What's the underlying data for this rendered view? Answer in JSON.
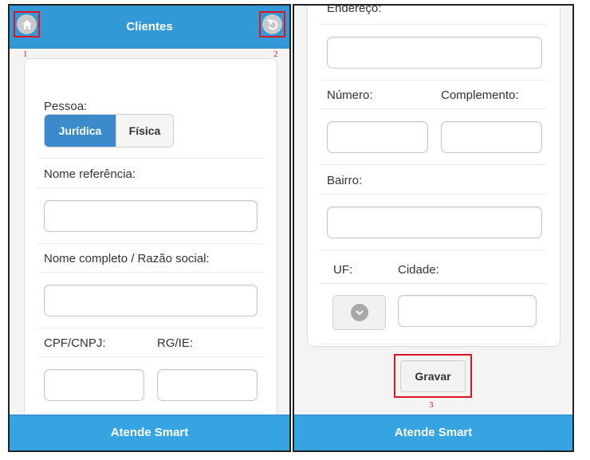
{
  "left_screen": {
    "header": {
      "title": "Clientes",
      "home_icon": "home-icon",
      "back_icon": "undo-icon"
    },
    "callouts": [
      "1",
      "2"
    ],
    "form": {
      "pessoa_label": "Pessoa:",
      "person_type_options": [
        "Jurídica",
        "Física"
      ],
      "selected_person_type": "Jurídica",
      "nome_referencia_label": "Nome referência:",
      "nome_referencia_value": "",
      "nome_completo_label": "Nome completo / Razão social:",
      "nome_completo_value": "",
      "cpf_cnpj_label": "CPF/CNPJ:",
      "cpf_cnpj_value": "",
      "rg_ie_label": "RG/IE:",
      "rg_ie_value": ""
    },
    "footer": {
      "title": "Atende Smart"
    }
  },
  "right_screen": {
    "form": {
      "endereco_label": "Endereço:",
      "endereco_value": "",
      "numero_label": "Número:",
      "numero_value": "",
      "complemento_label": "Complemento:",
      "complemento_value": "",
      "bairro_label": "Bairro:",
      "bairro_value": "",
      "uf_label": "UF:",
      "uf_selected": "",
      "cidade_label": "Cidade:",
      "cidade_value": ""
    },
    "save_button": "Gravar",
    "callout": "3",
    "footer": {
      "title": "Atende Smart"
    }
  },
  "colors": {
    "header_blue": "#3399d6",
    "footer_blue": "#35a4e0",
    "active_segment": "#3b8bcc",
    "callout_red": "#e0141e"
  }
}
